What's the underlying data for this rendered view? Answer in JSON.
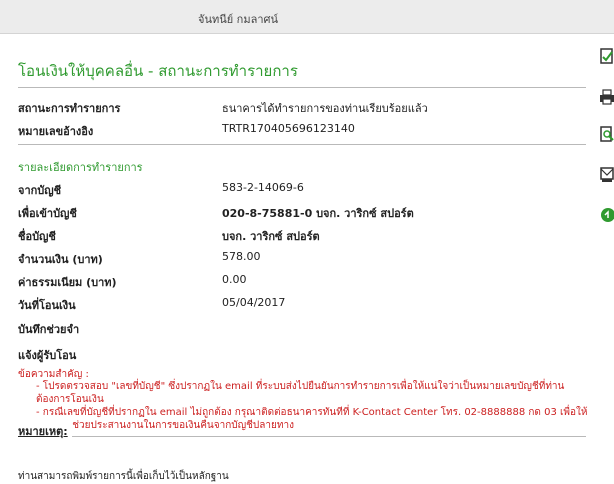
{
  "header": {
    "user_name": "จันทนีย์ กมลาศน์"
  },
  "page_title": "โอนเงินให้บุคคลอื่น - สถานะการทำรายการ",
  "status": {
    "label": "สถานะการทำรายการ",
    "value": "ธนาคารได้ทำรายการของท่านเรียบร้อยแล้ว"
  },
  "reference": {
    "label": "หมายเลขอ้างอิง",
    "value": "TRTR170405696123140"
  },
  "details": {
    "section_title": "รายละเอียดการทำรายการ",
    "rows": [
      {
        "label": "จากบัญชี",
        "value": "583-2-14069-6"
      },
      {
        "label": "เพื่อเข้าบัญชี",
        "value": "020-8-75881-0 บจก. วาริกซ์ สปอร์ต"
      },
      {
        "label": "ชื่อบัญชี",
        "value": "บจก. วาริกซ์ สปอร์ต"
      },
      {
        "label": "จำนวนเงิน (บาท)",
        "value": "578.00"
      },
      {
        "label": "ค่าธรรมเนียม (บาท)",
        "value": "0.00"
      },
      {
        "label": "วันที่โอนเงิน",
        "value": "05/04/2017"
      },
      {
        "label": "บันทึกช่วยจำ",
        "value": ""
      },
      {
        "label": "แจ้งผู้รับโอน",
        "value": ""
      }
    ]
  },
  "important": {
    "title": "ข้อความสำคัญ :",
    "items": [
      "- โปรดตรวจสอบ \"เลขที่บัญชี\" ซึ่งปรากฏใน email ที่ระบบส่งไปยืนยันการทำรายการเพื่อให้แน่ใจว่าเป็นหมายเลขบัญชีที่ท่านต้องการโอนเงิน",
      "- กรณีเลขที่บัญชีที่ปรากฏใน email ไม่ถูกต้อง กรุณาติดต่อธนาคารทันทีที่ K-Contact Center โทร. 02-8888888 กด 03 เพื่อให้ธนาคารช่วยประสานงานในการขอเงินคืนจากบัญชีปลายทาง"
    ]
  },
  "remark": {
    "title": "หมายเหตุ:",
    "text": "ท่านสามารถพิมพ์รายการนี้เพื่อเก็บไว้เป็นหลักฐาน"
  },
  "colors": {
    "accent_green": "#2f9a2f",
    "alert_red": "#cc2020"
  },
  "side_icons": [
    "document-check-icon",
    "print-icon",
    "document-search-icon",
    "email-icon",
    "green-circle-icon"
  ]
}
